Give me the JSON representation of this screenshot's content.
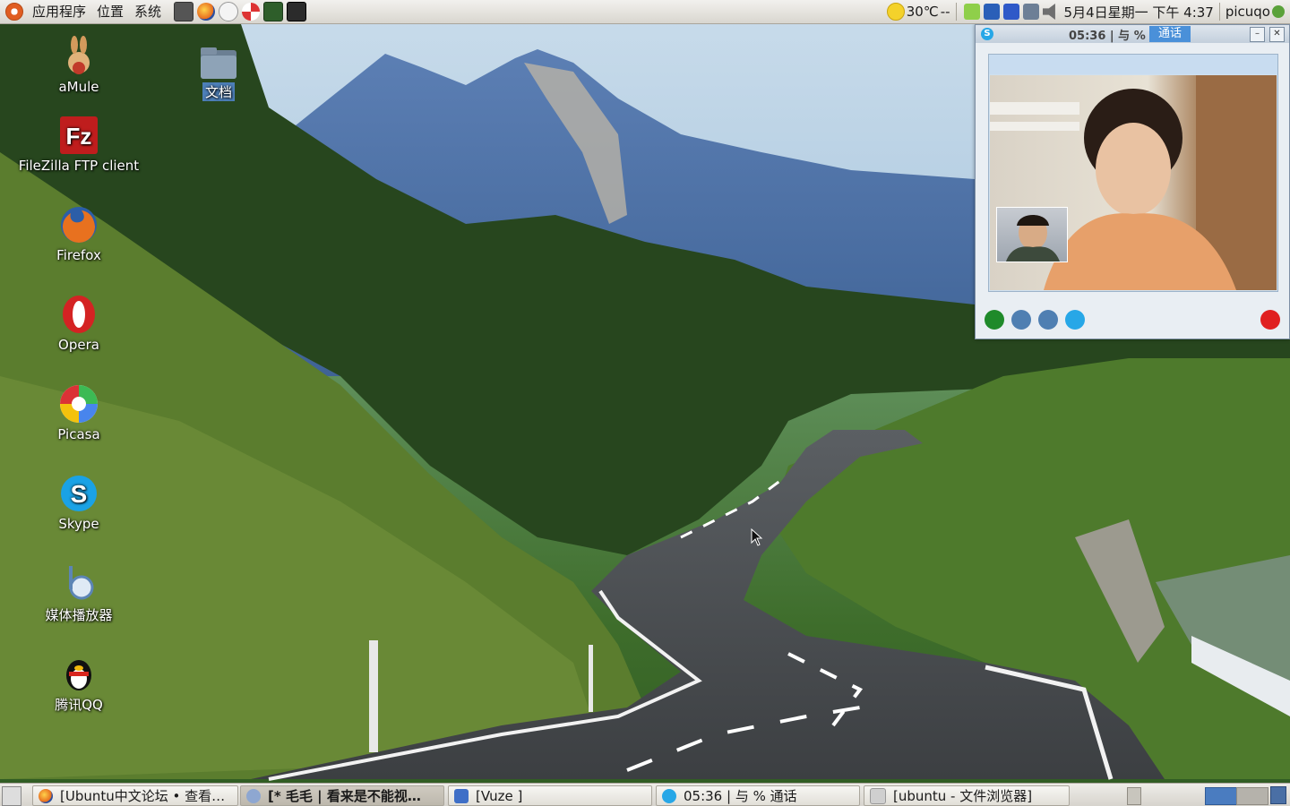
{
  "top_panel": {
    "menus": [
      "应用程序",
      "位置",
      "系统"
    ],
    "launchers": [
      "camera-icon",
      "firefox-icon",
      "clock-icon",
      "help-icon",
      "system-monitor-icon",
      "terminal-icon"
    ],
    "weather": "30℃",
    "weather_suffix": "--",
    "datetime": "5月4日星期一 下午 4:37",
    "user": "picuqo"
  },
  "desktop_icons": [
    {
      "label": "aMule",
      "icon": "amule-icon"
    },
    {
      "label": "文档",
      "icon": "folder-icon"
    },
    {
      "label": "FileZilla FTP client",
      "icon": "filezilla-icon"
    },
    {
      "label": "Firefox",
      "icon": "firefox-icon"
    },
    {
      "label": "Opera",
      "icon": "opera-icon"
    },
    {
      "label": "Picasa",
      "icon": "picasa-icon"
    },
    {
      "label": "Skype",
      "icon": "skype-icon"
    },
    {
      "label": "媒体播放器",
      "icon": "media-player-icon"
    },
    {
      "label": "腾讯QQ",
      "icon": "qq-icon"
    }
  ],
  "skype_window": {
    "title_time": "05:36 | 与 %",
    "title_call": "通话",
    "minimize": "–",
    "close": "✕"
  },
  "taskbar": {
    "tasks": [
      {
        "label": "[Ubuntu中文论坛 • 查看…",
        "icon": "firefox-icon",
        "active": false
      },
      {
        "label": "[* 毛毛 | 看来是不能视…",
        "icon": "pidgin-icon",
        "active": true
      },
      {
        "label": "[Vuze    ]",
        "icon": "vuze-icon",
        "active": false
      },
      {
        "label": "05:36 | 与 % 通话",
        "icon": "skype-icon",
        "active": false
      },
      {
        "label": "[ubuntu - 文件浏览器]",
        "icon": "file-browser-icon",
        "active": false
      }
    ]
  },
  "colors": {
    "panel_bg": "#d9d6cf",
    "skype_blue": "#27a7e7",
    "hangup_red": "#e02020",
    "call_green": "#1f8a2a"
  }
}
